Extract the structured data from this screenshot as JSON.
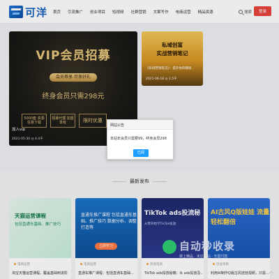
{
  "header": {
    "logo_text": "可洋",
    "nav": [
      "首页",
      "引流推广",
      "创业项目",
      "短视频",
      "社群营销",
      "文案写作",
      "电商运营",
      "精品资源"
    ],
    "search_label": "搜索",
    "login_label": "登录"
  },
  "hero": {
    "vip_title": "VIP会员招募",
    "vip_sub": "会员尊享 尽享好礼",
    "vip_price": "终身会员只需298元",
    "boxes": [
      "5000套 资源任意下载",
      "招募代理 加盟享有",
      "限时优惠"
    ],
    "title": "加入vip",
    "meta": "2021-05-30  ◎ 4.4千"
  },
  "side": {
    "title_line1": "私域创富",
    "title_line2": "实战营销笔记",
    "text": "《私域营销笔记》：提升你的赚钱...",
    "meta": "2021-06-18  ◎ 1.5千"
  },
  "modal": {
    "title": "网站公告",
    "body": "本站年会员只需要99，终身会员298",
    "button": "已阅"
  },
  "section": {
    "title": "最新发布"
  },
  "cards": [
    {
      "tag": "电商运营",
      "title": "淘宝天猫运营课程，覆盖基础到进阶",
      "img_title": "天猫运营课程",
      "img_sub": "包括直通车基础、推广技巧"
    },
    {
      "tag": "电商运营",
      "title": "直通车推广课程：包括直通车基础...",
      "img_title": "直通车推广课程 包括直通车基础、推广技巧 数据分析、调整打造等",
      "img_btn": "立即学习"
    },
    {
      "tag": "跨境电商",
      "title": "TikTok ads投放秘籍：ik ads投放及...",
      "img_title": "TikTok ads投流秘",
      "img_sub": "从零开始学TikTok投放"
    },
    {
      "tag": "创业项目",
      "title": "利用AI制作Q版古风娃娃视频，只需...",
      "img_title": "AI古风Q版娃娃 流量轻松翻倍"
    }
  ],
  "watermark": {
    "main": "自动秒收录",
    "sub": "做上精品 · 未达一站 · 无需付款"
  }
}
